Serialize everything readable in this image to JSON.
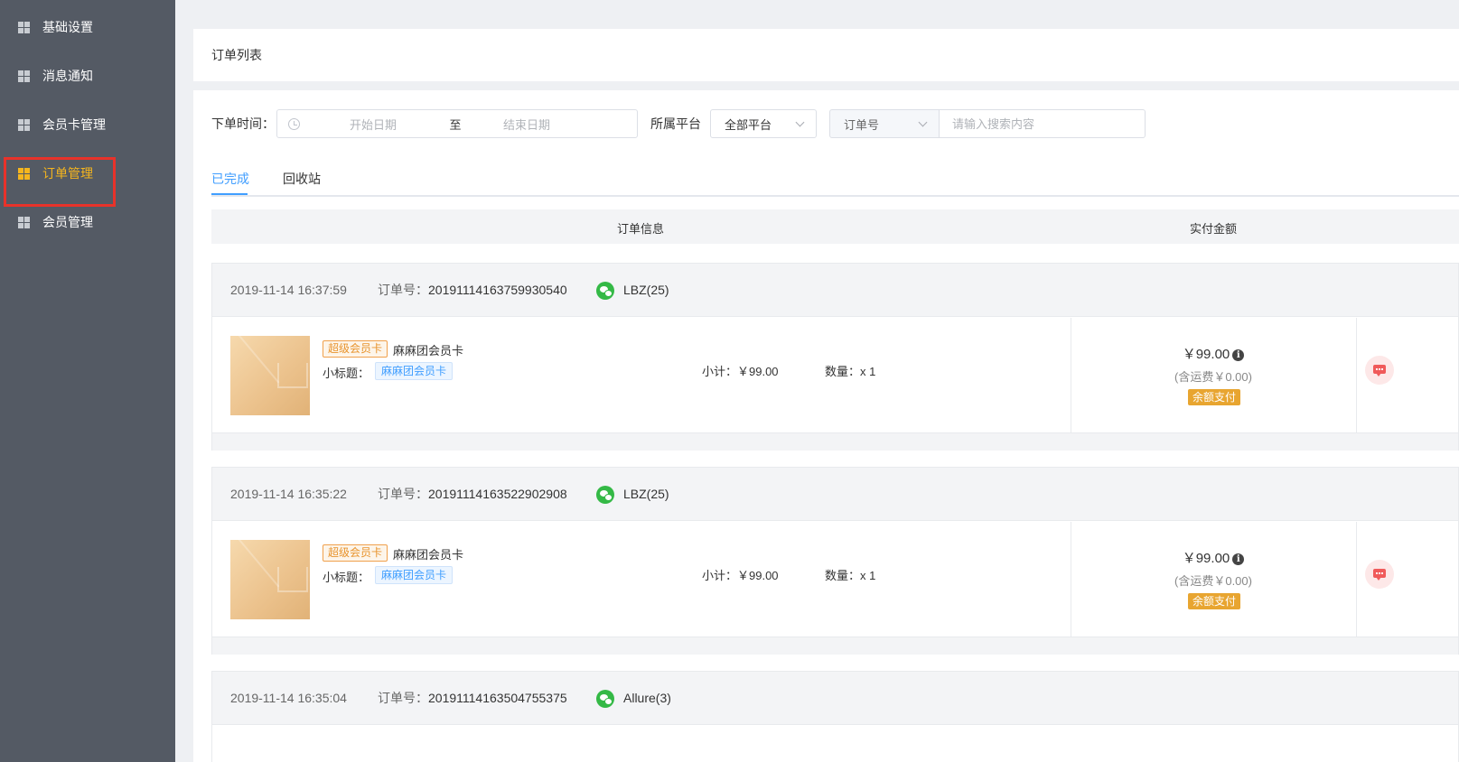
{
  "sidebar": {
    "items": [
      {
        "label": "基础设置"
      },
      {
        "label": "消息通知"
      },
      {
        "label": "会员卡管理"
      },
      {
        "label": "订单管理"
      },
      {
        "label": "会员管理"
      }
    ],
    "active_index": 3
  },
  "page_title": "订单列表",
  "filters": {
    "time_label": "下单时间：",
    "start_placeholder": "开始日期",
    "range_separator": "至",
    "end_placeholder": "结束日期",
    "platform_label": "所属平台",
    "platform_value": "全部平台",
    "search_type_value": "订单号",
    "search_placeholder": "请输入搜索内容"
  },
  "tabs": [
    {
      "label": "已完成",
      "active": true
    },
    {
      "label": "回收站",
      "active": false
    }
  ],
  "table_header": {
    "order_info": "订单信息",
    "paid_amount": "实付金额"
  },
  "labels": {
    "order_no": "订单号：",
    "subtitle": "小标题："
  },
  "orders": [
    {
      "time": "2019-11-14 16:37:59",
      "order_no": "20191114163759930540",
      "user": "LBZ(25)",
      "tag": "超级会员卡",
      "product_name": "麻麻团会员卡",
      "subtitle_value": "麻麻团会员卡",
      "subtotal": "小计：￥99.00",
      "quantity": "数量：x 1",
      "price": "￥99.00",
      "freight": "(含运费￥0.00)",
      "pay_method": "余额支付"
    },
    {
      "time": "2019-11-14 16:35:22",
      "order_no": "20191114163522902908",
      "user": "LBZ(25)",
      "tag": "超级会员卡",
      "product_name": "麻麻团会员卡",
      "subtitle_value": "麻麻团会员卡",
      "subtotal": "小计：￥99.00",
      "quantity": "数量：x 1",
      "price": "￥99.00",
      "freight": "(含运费￥0.00)",
      "pay_method": "余额支付"
    },
    {
      "time": "2019-11-14 16:35:04",
      "order_no": "20191114163504755375",
      "user": "Allure(3)"
    }
  ],
  "colors": {
    "sidebar_bg": "#545a64",
    "active_accent": "#f5b51e",
    "tab_active": "#409eff",
    "highlight": "#e8322a",
    "pay_badge": "#e8a530"
  }
}
